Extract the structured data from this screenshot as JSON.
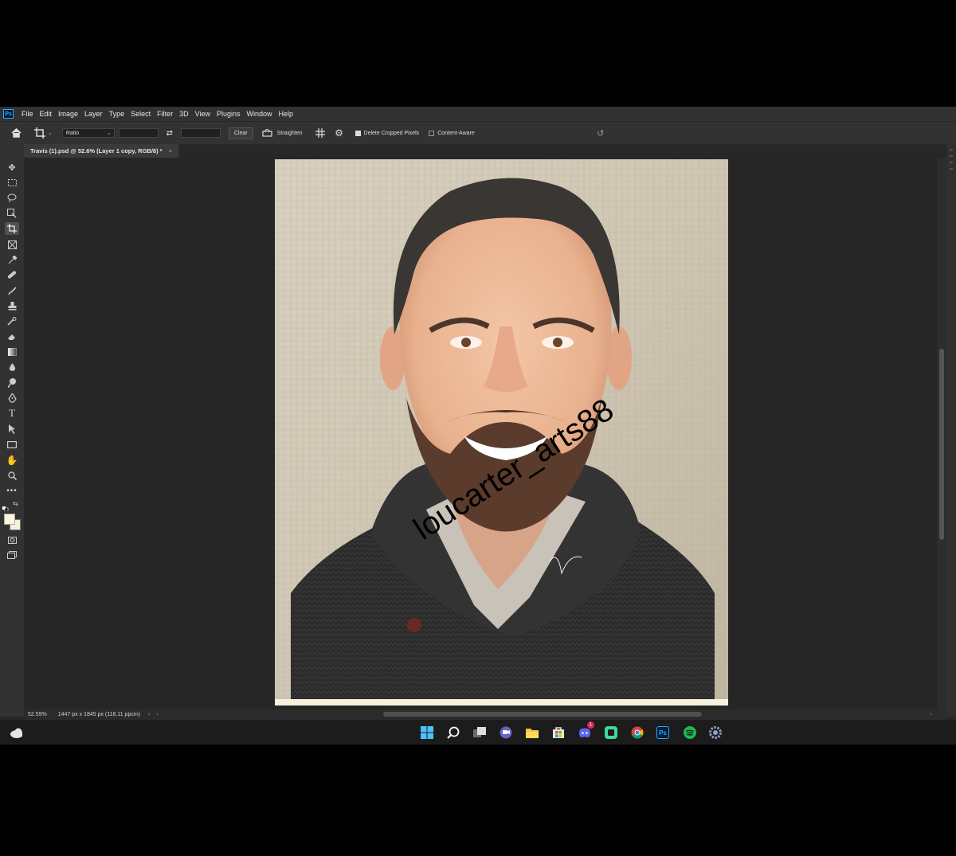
{
  "menubar": {
    "app_logo": "Ps",
    "items": [
      "File",
      "Edit",
      "Image",
      "Layer",
      "Type",
      "Select",
      "Filter",
      "3D",
      "View",
      "Plugins",
      "Window",
      "Help"
    ]
  },
  "options": {
    "ratio_value": "Ratio",
    "clear_label": "Clear",
    "straighten_label": "Straighten",
    "delete_cropped_label": "Delete Cropped Pixels",
    "delete_cropped_checked": true,
    "content_aware_label": "Content-Aware",
    "content_aware_checked": false
  },
  "document": {
    "tab_title": "Travis (1).psd @ 52.6% (Layer 1 copy, RGB/8) *",
    "close_glyph": "×",
    "watermark": "loucarter_arts88"
  },
  "status": {
    "zoom": "52.59%",
    "info": "1447 px x 1845 px (118.11 ppcm)",
    "arrow": "›"
  },
  "toolbar_icons": [
    "move-icon",
    "marquee-icon",
    "lasso-icon",
    "object-select-icon",
    "crop-icon",
    "frame-icon",
    "eyedropper-icon",
    "healing-icon",
    "brush-icon",
    "stamp-icon",
    "history-brush-icon",
    "eraser-icon",
    "gradient-icon",
    "blur-icon",
    "dodge-icon",
    "pen-icon",
    "type-icon",
    "path-select-icon",
    "rectangle-icon",
    "hand-icon",
    "zoom-icon",
    "more-tools-icon"
  ],
  "taskbar": {
    "discord_badge": "1"
  },
  "colors": {
    "accent": "#31a8ff",
    "app_bg": "#272727",
    "panel_bg": "#323232"
  }
}
